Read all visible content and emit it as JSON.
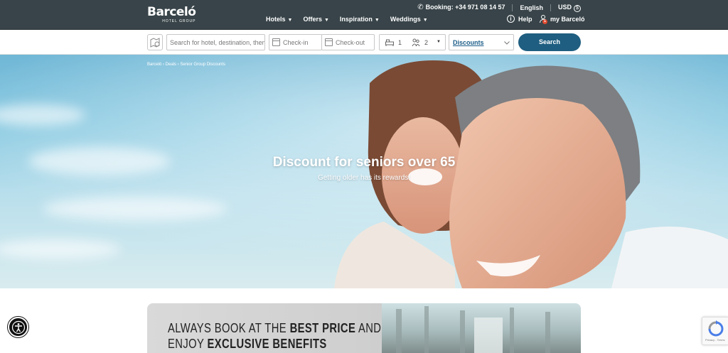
{
  "header": {
    "brand": "Barceló",
    "brand_sub": "HOTEL GROUP",
    "booking_label": "Booking: +34 971 08 14 57",
    "language": "English",
    "currency": "USD",
    "currency_symbol": "$",
    "nav": [
      "Hotels",
      "Offers",
      "Inspiration",
      "Weddings"
    ],
    "help": "Help",
    "my_account": "my Barceló",
    "notification_count": "1"
  },
  "search": {
    "destination_placeholder": "Search for hotel, destination, theme...",
    "checkin_placeholder": "Check-in",
    "checkout_placeholder": "Check-out",
    "rooms": "1",
    "guests": "2",
    "discounts": "Discounts",
    "search_button": "Search"
  },
  "hero": {
    "breadcrumb": "Barceló › Deals › Senior Group Discounts",
    "title": "Discount for seniors over 65",
    "subtitle": "Getting older has its rewards!"
  },
  "banner": {
    "line1_a": "ALWAYS BOOK AT THE ",
    "line1_b": "BEST PRICE",
    "line1_c": " AND",
    "line2_a": "ENJOY ",
    "line2_b": "EXCLUSIVE BENEFITS"
  },
  "colors": {
    "header_bg": "#384449",
    "search_button": "#1f5e80",
    "link": "#1a5c87"
  }
}
